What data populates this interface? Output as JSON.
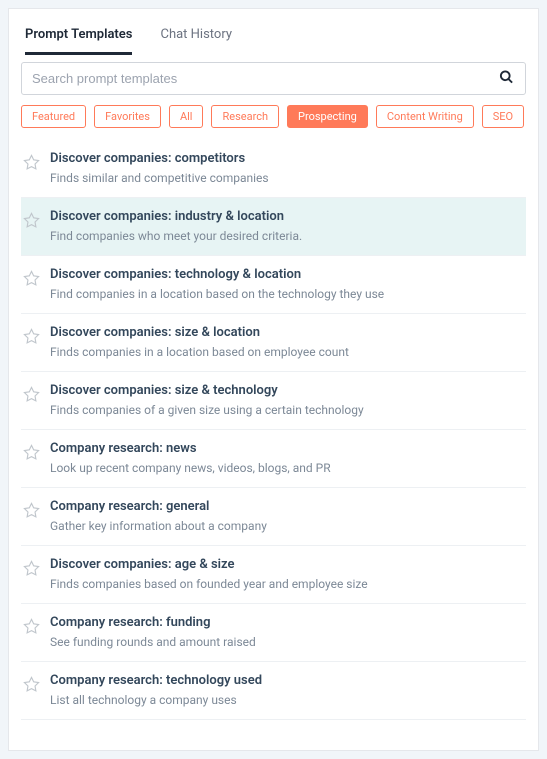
{
  "tabs": {
    "t0": {
      "label": "Prompt Templates",
      "active": true
    },
    "t1": {
      "label": "Chat History",
      "active": false
    }
  },
  "search": {
    "placeholder": "Search prompt templates"
  },
  "filters": {
    "f0": {
      "label": "Featured",
      "active": false
    },
    "f1": {
      "label": "Favorites",
      "active": false
    },
    "f2": {
      "label": "All",
      "active": false
    },
    "f3": {
      "label": "Research",
      "active": false
    },
    "f4": {
      "label": "Prospecting",
      "active": true
    },
    "f5": {
      "label": "Content Writing",
      "active": false
    },
    "f6": {
      "label": "SEO",
      "active": false
    }
  },
  "templates": [
    {
      "title": "Discover companies: competitors",
      "desc": "Finds similar and competitive companies",
      "highlight": false
    },
    {
      "title": "Discover companies: industry & location",
      "desc": "Find companies who meet your desired criteria.",
      "highlight": true
    },
    {
      "title": "Discover companies: technology & location",
      "desc": "Find companies in a location based on the technology they use",
      "highlight": false
    },
    {
      "title": "Discover companies: size & location",
      "desc": "Finds companies in a location based on employee count",
      "highlight": false
    },
    {
      "title": "Discover companies: size & technology",
      "desc": "Finds companies of a given size using a certain technology",
      "highlight": false
    },
    {
      "title": "Company research: news",
      "desc": "Look up recent company news, videos, blogs, and PR",
      "highlight": false
    },
    {
      "title": "Company research: general",
      "desc": "Gather key information about a company",
      "highlight": false
    },
    {
      "title": "Discover companies: age & size",
      "desc": "Finds companies based on founded year and employee size",
      "highlight": false
    },
    {
      "title": "Company research: funding",
      "desc": "See funding rounds and amount raised",
      "highlight": false
    },
    {
      "title": "Company research: technology used",
      "desc": "List all technology a company uses",
      "highlight": false
    }
  ]
}
